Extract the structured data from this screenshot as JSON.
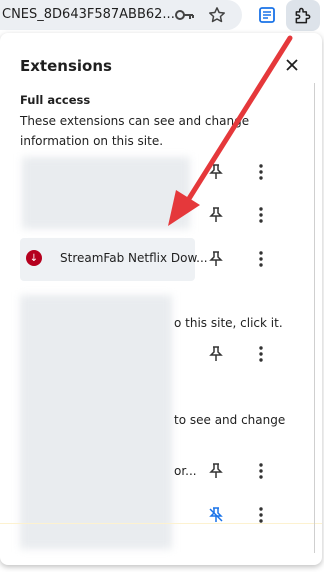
{
  "toolbar": {
    "url_text": "CNES_8D643F587ABB62...",
    "icons": [
      "key-icon",
      "star-icon",
      "reading-list-icon",
      "puzzle-icon"
    ]
  },
  "panel": {
    "title": "Extensions",
    "full_access_heading": "Full access",
    "full_access_desc": "These extensions can see and change information on this site.",
    "visible_extension": "StreamFab Netflix Dow...",
    "partial_text_1": "o this site, click it.",
    "partial_text_2": "to see and change",
    "partial_text_3": "or..."
  },
  "colors": {
    "accent_red": "#e5383b",
    "streamfab_red": "#b5001e",
    "extensions_button_bg": "#dde3ea",
    "unpin_blue": "#1a73e8"
  }
}
